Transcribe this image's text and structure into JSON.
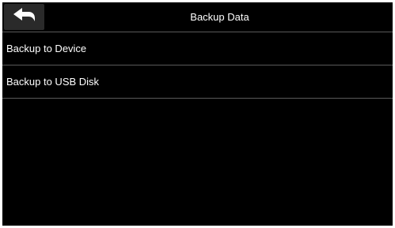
{
  "header": {
    "title": "Backup Data",
    "back_icon": "back-arrow-icon"
  },
  "menu": {
    "items": [
      {
        "label": "Backup to Device"
      },
      {
        "label": "Backup to USB Disk"
      }
    ]
  },
  "colors": {
    "background": "#000000",
    "text": "#ffffff",
    "divider": "#5a5a5a",
    "back_button": "#2a2a2a"
  }
}
